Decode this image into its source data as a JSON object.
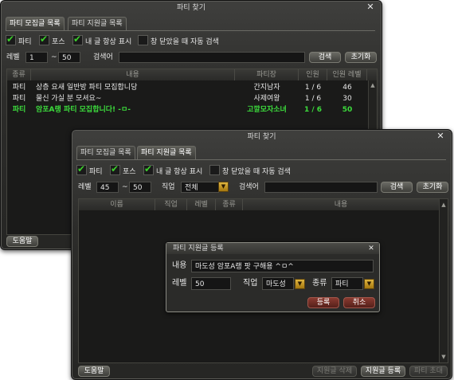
{
  "recruit_window": {
    "title": "파티 찾기",
    "tabs": [
      "파티 모집글 목록",
      "파티 지원글 목록"
    ],
    "filters": {
      "party": "파티",
      "force": "포스",
      "always_show_mine": "내 글 항상 표시",
      "auto_search_on_close": "창 닫았을 때 자동 검색"
    },
    "level_label": "레벨",
    "level_min": "1",
    "tilde": "~",
    "level_max": "50",
    "search_label": "검색어",
    "search_button": "검색",
    "reset_button": "초기화",
    "columns": [
      "종류",
      "내용",
      "파티장",
      "인원",
      "인원 레벨"
    ],
    "rows": [
      {
        "type": "파티",
        "content": "상층 요새 일반방 파티 모집합니당",
        "leader": "간지남자",
        "members": "1 / 6",
        "level": "46",
        "highlight": false
      },
      {
        "type": "파티",
        "content": "물신 가실 분 모셔요~",
        "leader": "사제여왕",
        "members": "1 / 6",
        "level": "30",
        "highlight": false
      },
      {
        "type": "파티",
        "content": "암포A랭 파티 모집합니다! -ㅁ-",
        "leader": "고깔모자소녀",
        "members": "1 / 6",
        "level": "50",
        "highlight": true
      }
    ],
    "help_button": "도움말"
  },
  "apply_window": {
    "title": "파티 찾기",
    "tabs": [
      "파티 모집글 목록",
      "파티 지원글 목록"
    ],
    "filters": {
      "party": "파티",
      "force": "포스",
      "always_show_mine": "내 글 항상 표시",
      "auto_search_on_close": "창 닫았을 때 자동 검색"
    },
    "level_label": "레벨",
    "level_min": "45",
    "tilde": "~",
    "level_max": "50",
    "class_label": "직업",
    "class_value": "전체",
    "search_label": "검색어",
    "search_button": "검색",
    "reset_button": "초기화",
    "columns": [
      "이름",
      "직업",
      "레벨",
      "종류",
      "내용"
    ],
    "help_button": "도움말",
    "delete_button": "지원글 삭제",
    "register_button": "지원글 등록",
    "invite_button": "파티 초대"
  },
  "register_dialog": {
    "title": "파티 지원글 등록",
    "content_label": "내용",
    "content_value": "마도성 암포A랭 팟 구해용 ^ㅁ^",
    "level_label": "레벨",
    "level_value": "50",
    "class_label": "직업",
    "class_value": "마도성",
    "type_label": "종류",
    "type_value": "파티",
    "ok_button": "등록",
    "cancel_button": "취소"
  },
  "colors": {
    "highlight_row": "#3cdc3c",
    "check": "#3ccf2c",
    "accent_arrow": "#d9a62a"
  }
}
